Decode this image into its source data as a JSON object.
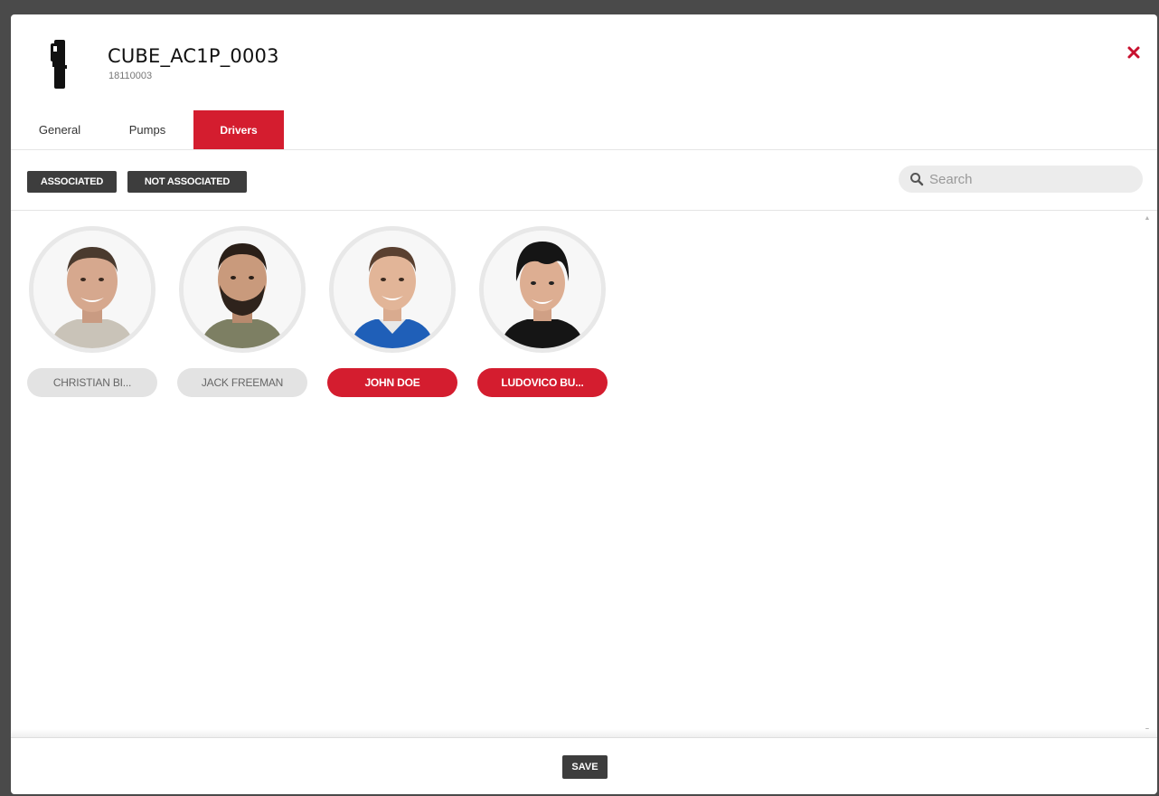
{
  "header": {
    "title": "CUBE_AC1P_0003",
    "subtitle": "18110003",
    "device_icon": "fuel-dispenser-icon",
    "close_icon": "close-icon",
    "accent_color": "#d41d2f"
  },
  "tabs": [
    {
      "label": "General",
      "active": false
    },
    {
      "label": "Pumps",
      "active": false
    },
    {
      "label": "Drivers",
      "active": true
    }
  ],
  "toolbar": {
    "associated_label": "ASSOCIATED",
    "not_associated_label": "NOT ASSOCIATED",
    "search_placeholder": "Search",
    "search_value": "",
    "search_icon": "search-icon"
  },
  "drivers": [
    {
      "name": "CHRISTIAN BI...",
      "selected": false
    },
    {
      "name": "JACK FREEMAN",
      "selected": false
    },
    {
      "name": "JOHN DOE",
      "selected": true
    },
    {
      "name": "LUDOVICO BU...",
      "selected": true
    }
  ],
  "footer": {
    "save_label": "SAVE"
  }
}
